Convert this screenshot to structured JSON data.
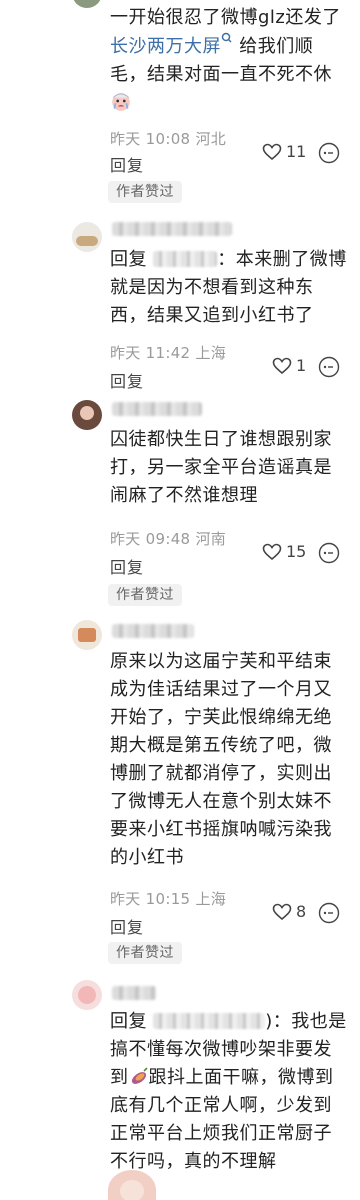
{
  "comments": [
    {
      "text_parts": [
        "一开始很忍了微博glz还发了",
        "长沙两万大屏",
        "给我们顺毛，结果对面一直不死不休"
      ],
      "meta": "昨天 10:08 河北",
      "reply": "回复",
      "likes": "11",
      "author_liked": "作者赞过"
    },
    {
      "reply_prefix": "回复",
      "text": "：本来删了微博就是因为不想看到这种东西，结果又追到小红书了",
      "meta": "昨天 11:42 上海",
      "reply": "回复",
      "likes": "1"
    },
    {
      "text": "囚徒都快生日了谁想跟别家打，另一家全平台造谣真是闹麻了不然谁想理",
      "meta": "昨天 09:48 河南",
      "reply": "回复",
      "likes": "15",
      "author_liked": "作者赞过"
    },
    {
      "text": "原来以为这届宁芙和平结束成为佳话结果过了一个月又开始了，宁芙此恨绵绵无绝期大概是第五传统了吧，微博删了就都消停了，实则出了微博无人在意个别太妹不要来小红书摇旗呐喊污染我的小红书",
      "meta": "昨天 10:15 上海",
      "reply": "回复",
      "likes": "8",
      "author_liked": "作者赞过"
    },
    {
      "reply_prefix": "回复",
      "text_parts": [
        ")：我也是搞不懂每次微博吵架非要发到",
        "跟抖上面干嘛，微博到底有几个正常人啊，少发到正常平台上烦我们正常厨子不行吗，真的不理解"
      ]
    }
  ],
  "icons": {
    "like": "heart-outline-icon",
    "more": "more-dots-icon",
    "search_link": "search-link-icon",
    "emoji": "crying-face-emoji"
  }
}
